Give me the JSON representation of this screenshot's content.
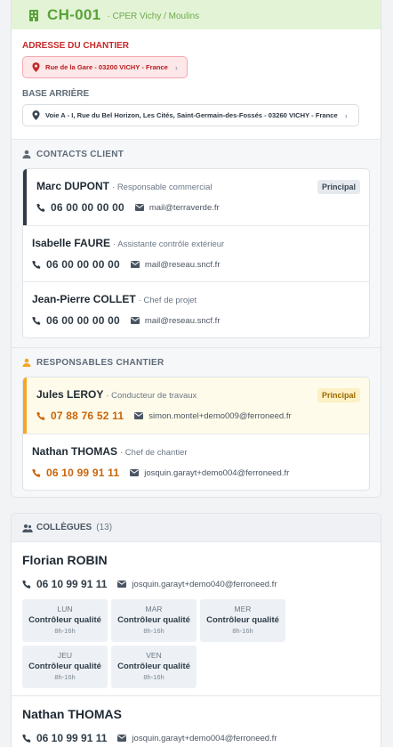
{
  "header": {
    "code": "CH-001",
    "subtitle": "· CPER Vichy / Moulins"
  },
  "address": {
    "label": "ADRESSE DU CHANTIER",
    "value": "Rue de la Gare - 03200 VICHY - France"
  },
  "base": {
    "label": "BASE ARRIÈRE",
    "value": "Voie A - I, Rue du Bel Horizon, Les Cités, Saint-Germain-des-Fossés - 03260 VICHY - France"
  },
  "client_contacts": {
    "title": "CONTACTS CLIENT",
    "items": [
      {
        "name": "Marc DUPONT",
        "role": "· Responsable commercial",
        "phone": "06 00 00 00 00",
        "email": "mail@terraverde.fr",
        "badge": "Principal"
      },
      {
        "name": "Isabelle FAURE",
        "role": "· Assistante contrôle extérieur",
        "phone": "06 00 00 00 00",
        "email": "mail@reseau.sncf.fr"
      },
      {
        "name": "Jean-Pierre COLLET",
        "role": "· Chef de projet",
        "phone": "06 00 00 00 00",
        "email": "mail@reseau.sncf.fr"
      }
    ]
  },
  "site_managers": {
    "title": "RESPONSABLES CHANTIER",
    "items": [
      {
        "name": "Jules LEROY",
        "role": "· Conducteur de travaux",
        "phone": "07 88 76 52 11",
        "email": "simon.montel+demo009@ferroneed.fr",
        "badge": "Principal"
      },
      {
        "name": "Nathan THOMAS",
        "role": "· Chef de chantier",
        "phone": "06 10 99 91 11",
        "email": "josquin.garayt+demo004@ferroneed.fr"
      }
    ]
  },
  "colleagues": {
    "title": "COLLÈGUES",
    "count": "(13)",
    "items": [
      {
        "name": "Florian ROBIN",
        "phone": "06 10 99 91 11",
        "email": "josquin.garayt+demo040@ferroneed.fr",
        "schedule": [
          {
            "day": "LUN",
            "role": "Contrôleur qualité",
            "hours": "8h-16h"
          },
          {
            "day": "MAR",
            "role": "Contrôleur qualité",
            "hours": "8h-16h"
          },
          {
            "day": "MER",
            "role": "Contrôleur qualité",
            "hours": "8h-16h"
          },
          {
            "day": "JEU",
            "role": "Contrôleur qualité",
            "hours": "8h-16h"
          },
          {
            "day": "VEN",
            "role": "Contrôleur qualité",
            "hours": "8h-16h"
          }
        ]
      },
      {
        "name": "Nathan THOMAS",
        "phone": "06 10 99 91 11",
        "email": "josquin.garayt+demo004@ferroneed.fr"
      }
    ]
  },
  "colors": {
    "accent_green": "#5aa23a",
    "alert_red": "#c62828",
    "warning_orange": "#f5a623",
    "dark": "#2f3c48"
  }
}
